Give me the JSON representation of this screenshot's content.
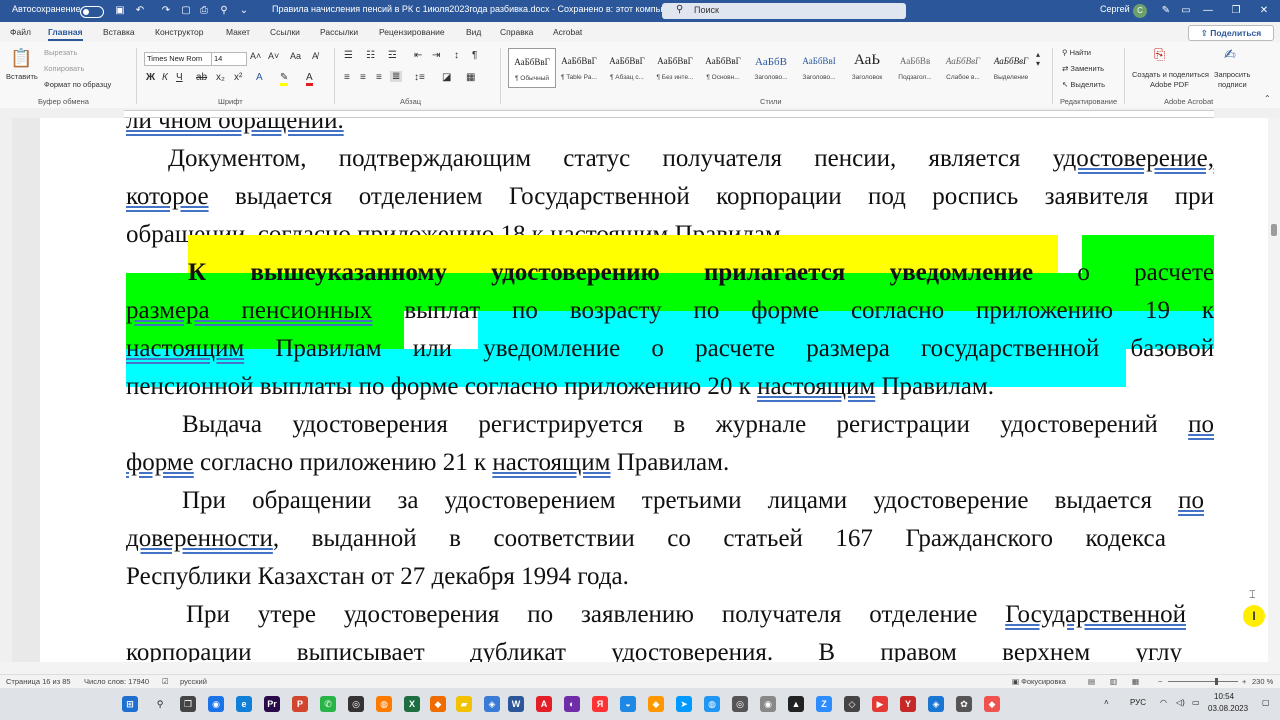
{
  "titlebar": {
    "autosave_label": "Автосохранение",
    "doc_title": "Правила начисления пенсий в РК с 1июля2023года разбивка.docx  -  Сохранено в: этот компьютер",
    "search_placeholder": "Поиск",
    "user_name": "Сергей",
    "user_initial": "С"
  },
  "tabs": [
    "Файл",
    "Главная",
    "Вставка",
    "Конструктор",
    "Макет",
    "Ссылки",
    "Рассылки",
    "Рецензирование",
    "Вид",
    "Справка",
    "Acrobat"
  ],
  "share_label": "Поделиться",
  "ribbon": {
    "clipboard": {
      "paste": "Вставить",
      "cut": "Вырезать",
      "copy": "Копировать",
      "format_painter": "Формат по образцу",
      "group": "Буфер обмена"
    },
    "font": {
      "name": "Times New Rom",
      "size": "14",
      "group": "Шрифт"
    },
    "paragraph_group": "Абзац",
    "styles": [
      {
        "sample": "АаБбВвГ",
        "name": "¶ Обычный"
      },
      {
        "sample": "АаБбВвГ",
        "name": "¶ Table Pa..."
      },
      {
        "sample": "АаБбВвГ",
        "name": "¶ Абзац с..."
      },
      {
        "sample": "АаБбВвГ",
        "name": "¶ Без инте..."
      },
      {
        "sample": "АаБбВвГ",
        "name": "¶ Основн..."
      },
      {
        "sample": "АаБбВ",
        "name": "Заголово..."
      },
      {
        "sample": "АаБбВвІ",
        "name": "Заголово..."
      },
      {
        "sample": "АаЬ",
        "name": "Заголовок"
      },
      {
        "sample": "АаБбВв",
        "name": "Подзагол..."
      },
      {
        "sample": "АаБбВвГ",
        "name": "Слабое в..."
      },
      {
        "sample": "АаБбВвГ",
        "name": "Выделение"
      }
    ],
    "styles_group": "Стили",
    "editing": {
      "find": "Найти",
      "replace": "Заменить",
      "select": "Выделить",
      "group": "Редактирование"
    },
    "acrobat": {
      "create_share": "Создать и поделиться",
      "create_share2": "Adobe PDF",
      "request_sign": "Запросить",
      "request_sign2": "подписи",
      "group": "Adobe Acrobat"
    }
  },
  "document": {
    "lines": {
      "l0": "ли чном обращении.",
      "l1a": "Документом, подтверждающим статус получателя пенсии, является ",
      "l1b": "удостоверение,",
      "l2a": "которое",
      "l2b": " выдается отделением Государственной корпорации под роспись заявителя при",
      "l3a": "обращении, согласно приложению 18 к ",
      "l3b": "настоящим",
      "l3c": " Правилам.",
      "l4a": "К вышеуказанному удостоверению прилагается уведомление",
      "l4b": " о расчете",
      "l5a": "размера пенсионных",
      "l5b": " выплат по возрасту по форме согласно приложению 19 к",
      "l6a": "настоящим",
      "l6b": " Правилам",
      "l6c": " или ",
      "l6d": "уведомление о расчете размера государственной базовой",
      "l7a": "пенсионной  выплаты по форме согласно приложению 20 к ",
      "l7b": "настоящим",
      "l7c": " Правилам",
      "l7d": ".",
      "l8a": "Выдача удостоверения регистрируется в журнале регистрации удостоверений ",
      "l8b": "по",
      "l9a": "форме",
      "l9b": " согласно приложению 21 к ",
      "l9c": "настоящим",
      "l9d": " Правилам.",
      "l10a": "При обращении за удостоверением третьими лицами удостоверение выдается ",
      "l10b": "по",
      "l11a": "доверенности",
      "l11b": ", выданной в соответствии со статьей 167 Гражданского кодекса",
      "l12": "Республики Казахстан от 27 декабря 1994 года.",
      "l13a": "При утере удостоверения по заявлению получателя отделение ",
      "l13b": "Государственной",
      "l14": "корпорации выписывает дубликат удостоверения. В правом верхнем углу"
    }
  },
  "statusbar": {
    "page": "Страница 16 из 85",
    "words": "Число слов: 17940",
    "lang": "русский",
    "focus": "Фокусировка",
    "zoom": "230 %"
  },
  "taskbar": {
    "lang": "РУС",
    "time": "10:54",
    "date": "03.08.2023"
  },
  "colors": {
    "word_blue": "#2b579a",
    "highlight_yellow": "#ffff00",
    "highlight_green": "#00ff00",
    "highlight_cyan": "#00ffff"
  }
}
